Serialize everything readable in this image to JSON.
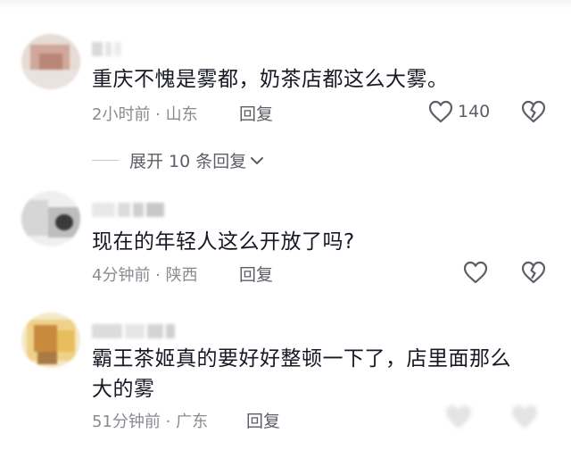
{
  "comments": [
    {
      "text": "重庆不愧是雾都，奶茶店都这么大雾。",
      "time_location": "2小时前 · 山东",
      "reply_label": "回复",
      "like_count": "140",
      "expand_label": "展开 10 条回复"
    },
    {
      "text": "现在的年轻人这么开放了吗?",
      "time_location": "4分钟前 · 陕西",
      "reply_label": "回复"
    },
    {
      "text": "霸王茶姬真的要好好整顿一下了，店里面那么大的雾",
      "time_location": "51分钟前 · 广东",
      "reply_label": "回复"
    }
  ],
  "icons": {
    "like": "heart-outline-icon",
    "dislike": "broken-heart-icon",
    "expand": "chevron-down-icon"
  },
  "colors": {
    "text_primary": "#161823",
    "text_secondary": "#8a8b91",
    "action_text": "#5d5e66",
    "icon_stroke": "#5d5e66",
    "background": "#ffffff"
  }
}
